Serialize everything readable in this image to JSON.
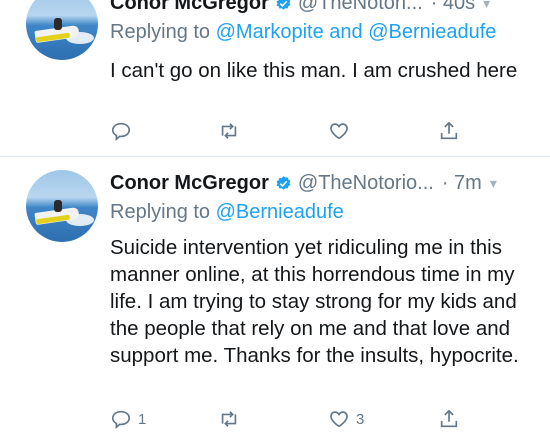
{
  "tweets": [
    {
      "name": "Conor McGregor",
      "handle": "@TheNotori...",
      "time": "40s",
      "reply_label": "Replying to",
      "reply_targets": "@Markopite and @Bernieadufe",
      "text": "I can't go on like this man. I am crushed here",
      "reply_count": "",
      "retweet_count": "",
      "like_count": ""
    },
    {
      "name": "Conor McGregor",
      "handle": "@TheNotorio...",
      "time": "7m",
      "reply_label": "Replying to",
      "reply_targets": "@Bernieadufe",
      "text": "Suicide intervention yet ridiculing me in this manner online, at this horrendous time in my life. I am trying to stay strong for my kids and the people that rely on me and that love and support me. Thanks for the insults, hypocrite.",
      "reply_count": "1",
      "retweet_count": "",
      "like_count": "3"
    }
  ],
  "icons": {
    "verified": "verified-badge-icon",
    "reply": "reply-icon",
    "retweet": "retweet-icon",
    "like": "like-icon",
    "share": "share-icon",
    "menu": "chevron-down-icon"
  },
  "colors": {
    "link": "#1da1f2",
    "muted": "#657786",
    "text": "#14171a",
    "verified": "#1da1f2"
  }
}
